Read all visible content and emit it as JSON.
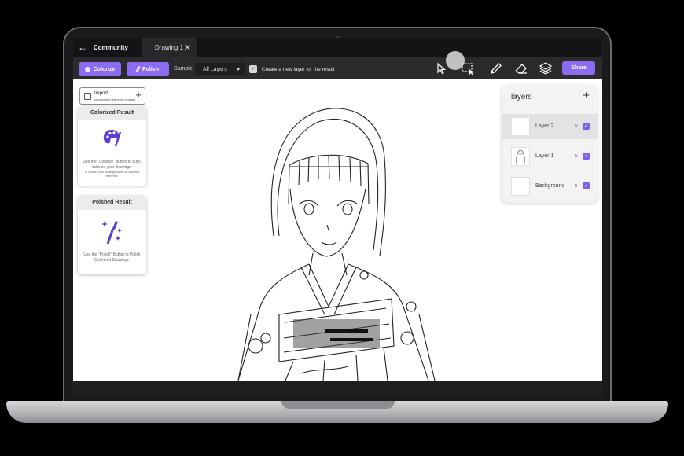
{
  "tabbar": {
    "back_label": "Community",
    "tab_label": "Drawing 1",
    "close_glyph": "✕"
  },
  "toolbar": {
    "colorize_label": "Colorize",
    "polish_label": "Polish",
    "sample_label": "Sample:",
    "sample_value": "All Layers",
    "new_layer_label": "Create a new layer for the result",
    "new_layer_checked": true,
    "share_label": "Share",
    "tools": [
      "pointer-icon",
      "lasso-select-icon",
      "pencil-icon",
      "eraser-icon",
      "layers-icon"
    ]
  },
  "import": {
    "title": "Import",
    "subtitle": "colorization reference images"
  },
  "colorized_panel": {
    "title": "Colorized Result",
    "desc": "Use the \"Colorize\" button to auto-colorize your drawings.",
    "desc_small": "or colorize your drawings based on imported reference."
  },
  "polished_panel": {
    "title": "Poished Result",
    "desc": "Use the \"Polish\" Button to Polish Colorized Drawings."
  },
  "layers_panel": {
    "title": "layers",
    "add_glyph": "+",
    "items": [
      {
        "name": "Layer 2",
        "mode": "N",
        "selected": true
      },
      {
        "name": "Layer 1",
        "mode": "N",
        "selected": false
      },
      {
        "name": "Background",
        "mode": "B",
        "selected": false
      }
    ]
  },
  "colors": {
    "accent": "#8b6cf0",
    "toolbar": "#2b2b2e",
    "tabbar": "#141416"
  }
}
